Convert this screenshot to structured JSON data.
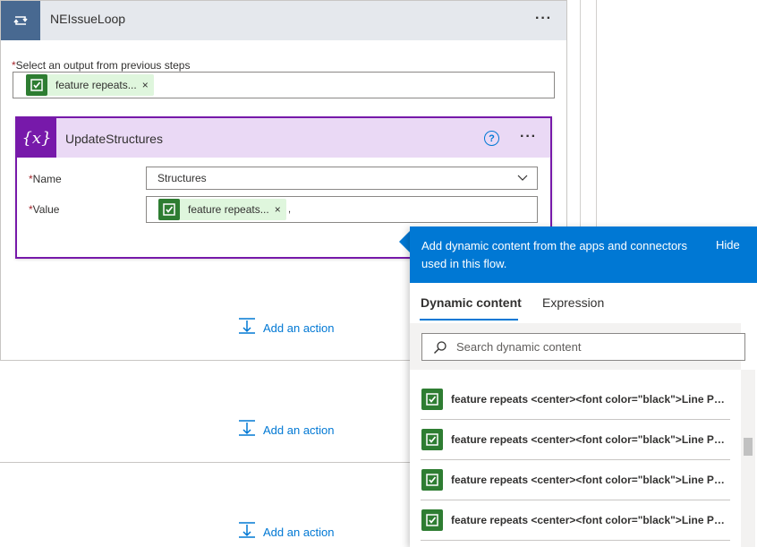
{
  "loop": {
    "title": "NEIssueLoop",
    "more": "···",
    "output_label": "Select an output from previous steps",
    "required_mark": "*",
    "token_text": "feature repeats...",
    "token_remove": "×"
  },
  "variable_card": {
    "icon_text": "{x}",
    "title": "UpdateStructures",
    "help": "?",
    "more": "···",
    "name_label": "Name",
    "name_value": "Structures",
    "value_label": "Value",
    "value_token": "feature repeats...",
    "value_token_remove": "×",
    "value_suffix": ","
  },
  "add_action_label": "Add an action",
  "panel": {
    "message": "Add dynamic content from the apps and connectors used in this flow.",
    "hide": "Hide",
    "tabs": [
      "Dynamic content",
      "Expression"
    ],
    "search_placeholder": "Search dynamic content",
    "items": [
      "feature repeats <center><font color=\"black\">Line Patr...",
      "feature repeats <center><font color=\"black\">Line Patr...",
      "feature repeats <center><font color=\"black\">Line Patr...",
      "feature repeats <center><font color=\"black\">Line Patr..."
    ]
  },
  "colors": {
    "loop_accent": "#486991",
    "variable_accent": "#7719aa",
    "panel_accent": "#0078d4",
    "token_bg": "#dff6dd",
    "token_icon": "#2e7d32"
  }
}
